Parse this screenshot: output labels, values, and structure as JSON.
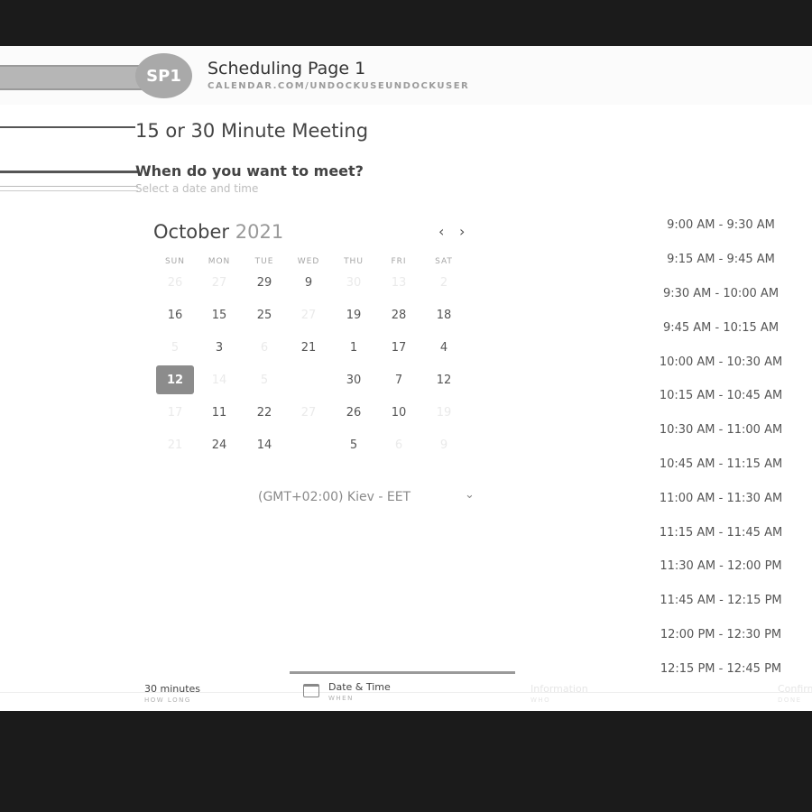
{
  "header": {
    "avatar_initials": "SP1",
    "page_name": "Scheduling Page 1",
    "url": "CALENDAR.COM/UNDOCKUSEUNDOCKUSER"
  },
  "meeting": {
    "title": "15 or 30 Minute Meeting",
    "question": "When do you want to meet?",
    "instruction": "Select a date and time"
  },
  "calendar": {
    "month": "October",
    "year": "2021",
    "prev_icon": "chevron-left-icon",
    "next_icon": "chevron-right-icon",
    "weekdays": [
      "SUN",
      "MON",
      "TUE",
      "WED",
      "THU",
      "FRI",
      "SAT"
    ],
    "weeks": [
      [
        {
          "d": "26",
          "dim": true
        },
        {
          "d": "27",
          "dim": true
        },
        {
          "d": "29",
          "dim": false
        },
        {
          "d": "9",
          "dim": false
        },
        {
          "d": "30",
          "dim": true
        },
        {
          "d": "13",
          "dim": true
        },
        {
          "d": "2",
          "dim": true
        }
      ],
      [
        {
          "d": "16",
          "dim": false
        },
        {
          "d": "15",
          "dim": false
        },
        {
          "d": "25",
          "dim": false
        },
        {
          "d": "27",
          "dim": true
        },
        {
          "d": "19",
          "dim": false
        },
        {
          "d": "28",
          "dim": false
        },
        {
          "d": "18",
          "dim": false
        }
      ],
      [
        {
          "d": "5",
          "dim": true
        },
        {
          "d": "3",
          "dim": false
        },
        {
          "d": "6",
          "dim": true
        },
        {
          "d": "21",
          "dim": false
        },
        {
          "d": "1",
          "dim": false
        },
        {
          "d": "17",
          "dim": false
        },
        {
          "d": "4",
          "dim": false
        }
      ],
      [
        {
          "d": "12",
          "dim": false,
          "selected": true
        },
        {
          "d": "14",
          "dim": true
        },
        {
          "d": "5",
          "dim": true
        },
        {
          "d": "",
          "dim": true
        },
        {
          "d": "30",
          "dim": false
        },
        {
          "d": "7",
          "dim": false
        },
        {
          "d": "12",
          "dim": false
        }
      ],
      [
        {
          "d": "17",
          "dim": true
        },
        {
          "d": "11",
          "dim": false
        },
        {
          "d": "22",
          "dim": false
        },
        {
          "d": "27",
          "dim": true
        },
        {
          "d": "26",
          "dim": false
        },
        {
          "d": "10",
          "dim": false
        },
        {
          "d": "19",
          "dim": true
        }
      ],
      [
        {
          "d": "21",
          "dim": true
        },
        {
          "d": "24",
          "dim": false
        },
        {
          "d": "14",
          "dim": false
        },
        {
          "d": "",
          "dim": true
        },
        {
          "d": "5",
          "dim": false
        },
        {
          "d": "6",
          "dim": true
        },
        {
          "d": "9",
          "dim": true
        }
      ]
    ],
    "timezone": "(GMT+02:00) Kiev - EET"
  },
  "time_slots": [
    "9:00 AM - 9:30 AM",
    "9:15 AM - 9:45 AM",
    "9:30 AM - 10:00 AM",
    "9:45 AM - 10:15 AM",
    "10:00 AM - 10:30 AM",
    "10:15 AM - 10:45 AM",
    "10:30 AM - 11:00 AM",
    "10:45 AM - 11:15 AM",
    "11:00 AM - 11:30 AM",
    "11:15 AM - 11:45 AM",
    "11:30 AM - 12:00 PM",
    "11:45 AM - 12:15 PM",
    "12:00 PM - 12:30 PM",
    "12:15 PM - 12:45 PM"
  ],
  "footer": {
    "duration": {
      "value": "30 minutes",
      "label": "HOW LONG"
    },
    "datetime": {
      "value": "Date & Time",
      "label": "WHEN",
      "icon": "calendar-icon"
    },
    "step3": {
      "value": "Information",
      "label": "WHO"
    },
    "step4": {
      "value": "Confirm",
      "label": "DONE"
    }
  },
  "colors": {
    "selected_day": "#8c8c8c",
    "avatar": "#a9a9a9"
  }
}
